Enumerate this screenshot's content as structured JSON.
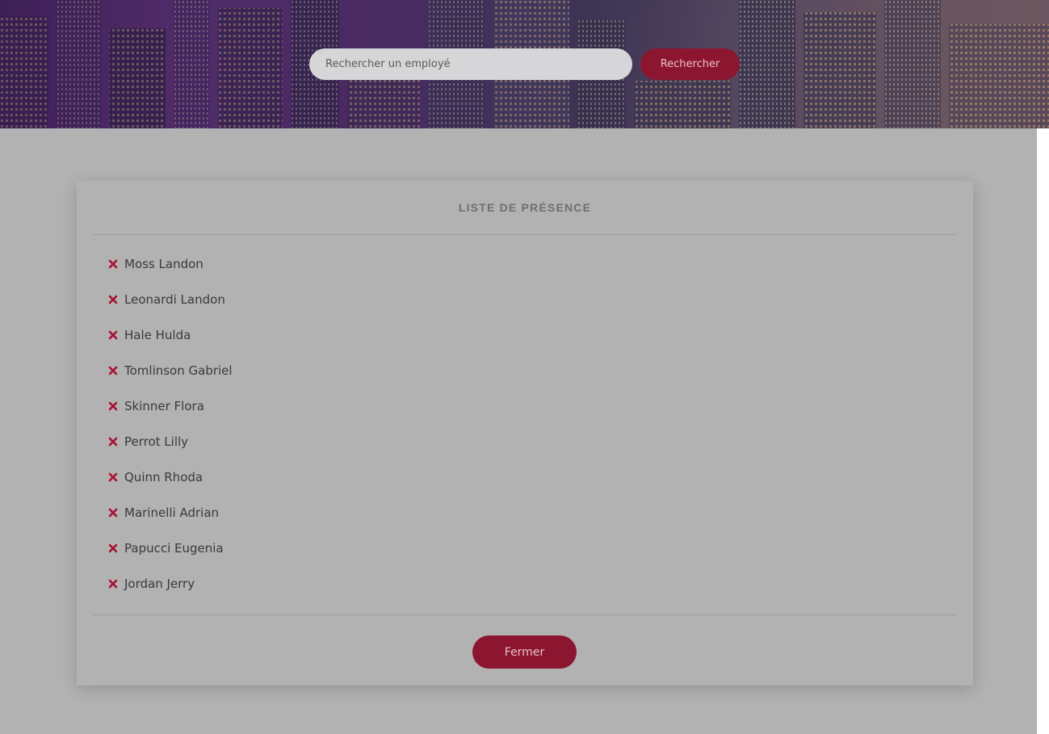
{
  "search": {
    "placeholder": "Rechercher un employé",
    "button_label": "Rechercher"
  },
  "modal": {
    "title": "LISTE DE PRÉSENCE",
    "close_label": "Fermer",
    "employees": [
      {
        "name": "Moss Landon",
        "status_icon": "close-icon"
      },
      {
        "name": "Leonardi Landon",
        "status_icon": "close-icon"
      },
      {
        "name": "Hale Hulda",
        "status_icon": "close-icon"
      },
      {
        "name": "Tomlinson Gabriel",
        "status_icon": "close-icon"
      },
      {
        "name": "Skinner Flora",
        "status_icon": "close-icon"
      },
      {
        "name": "Perrot Lilly",
        "status_icon": "close-icon"
      },
      {
        "name": "Quinn Rhoda",
        "status_icon": "close-icon"
      },
      {
        "name": "Marinelli Adrian",
        "status_icon": "close-icon"
      },
      {
        "name": "Papucci Eugenia",
        "status_icon": "close-icon"
      },
      {
        "name": "Jordan Jerry",
        "status_icon": "close-icon"
      }
    ]
  },
  "colors": {
    "accent": "#8c1530",
    "absent_icon": "#a8102e",
    "overlay": "#b2b2b2"
  }
}
